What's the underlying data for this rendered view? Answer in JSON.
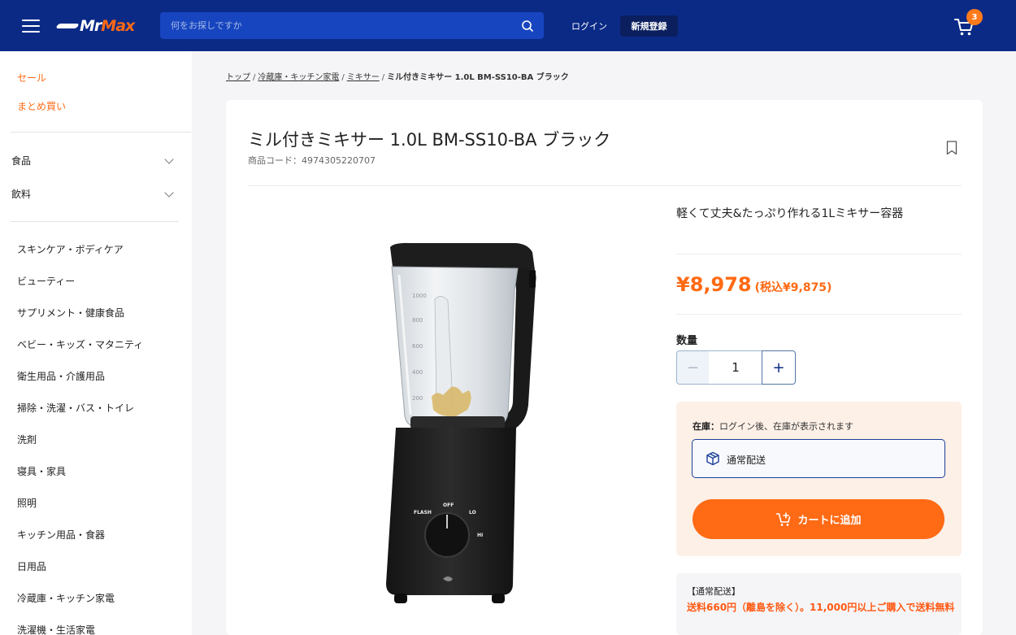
{
  "header": {
    "logo_mr": "Mr",
    "logo_max": "Max",
    "search_placeholder": "何をお探しですか",
    "login_label": "ログイン",
    "signup_label": "新規登録",
    "cart_count": "3",
    "icons": [
      "menu-icon",
      "search-icon",
      "cart-icon"
    ],
    "colors": {
      "header_bg": "#0a2a86",
      "accent": "#ff6a14"
    }
  },
  "sidebar": {
    "top_links": [
      "セール",
      "まとめ買い"
    ],
    "expandable": [
      "食品",
      "飲料"
    ],
    "categories": [
      "スキンケア・ボディケア",
      "ビューティー",
      "サプリメント・健康食品",
      "ベビー・キッズ・マタニティ",
      "衛生用品・介護用品",
      "掃除・洗濯・バス・トイレ",
      "洗剤",
      "寝具・家具",
      "照明",
      "キッチン用品・食器",
      "日用品",
      "冷蔵庫・キッチン家電",
      "洗濯機・生活家電"
    ]
  },
  "breadcrumb": {
    "items": [
      "トップ",
      "冷蔵庫・キッチン家電",
      "ミキサー"
    ],
    "separator": "/",
    "current": "ミル付きミキサー 1.0L BM-SS10-BA ブラック"
  },
  "product": {
    "title": "ミル付きミキサー 1.0L BM-SS10-BA ブラック",
    "code_label": "商品コード：4974305220707",
    "tagline": "軽くて丈夫&たっぷり作れる1Lミキサー容器",
    "price": "¥8,978",
    "price_tax": "(税込¥9,875)",
    "quantity_label": "数量",
    "quantity_value": "1",
    "minus": "−",
    "plus": "+",
    "image_labels": {
      "jar_marks": [
        "1000",
        "800",
        "600",
        "400",
        "200"
      ],
      "dial_off": "OFF",
      "dial_flash": "FLASH",
      "dial_lo": "LO",
      "dial_hi": "HI"
    }
  },
  "stock": {
    "label": "在庫：",
    "text": "ログイン後、在庫が表示されます",
    "shipping_option": "通常配送",
    "add_to_cart": "カートに追加"
  },
  "shipping_info": {
    "title": "【通常配送】",
    "text": "送料660円（離島を除く）。11,000円以上ご購入で送料無料"
  }
}
